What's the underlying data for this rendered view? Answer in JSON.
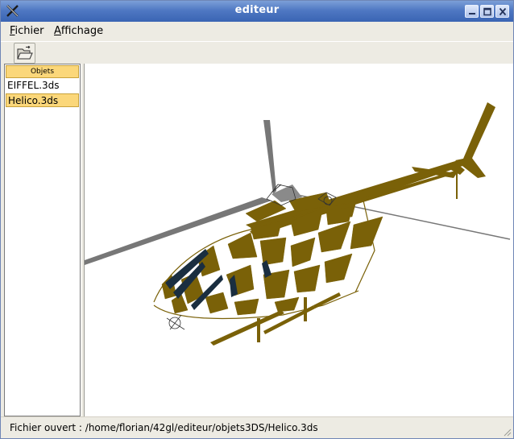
{
  "window": {
    "title": "editeur"
  },
  "menu": {
    "items": [
      {
        "mnemonic": "F",
        "rest": "ichier"
      },
      {
        "mnemonic": "A",
        "rest": "ffichage"
      }
    ]
  },
  "toolbar": {
    "open_icon": "folder-open-icon"
  },
  "objects_panel": {
    "header": "Objets",
    "items": [
      "EIFFEL.3ds",
      "Helico.3ds"
    ],
    "selected_index": 1
  },
  "viewport": {
    "model": "helicopter-wireframe",
    "colors": {
      "fill": "#7a6108",
      "rotor": "#777777",
      "dark": "#1a2e40"
    }
  },
  "status": {
    "text": "Fichier ouvert : /home/florian/42gl/editeur/objets3DS/Helico.3ds"
  },
  "colors": {
    "titlebar": "#4f78c3",
    "selection": "#fbd77a"
  }
}
